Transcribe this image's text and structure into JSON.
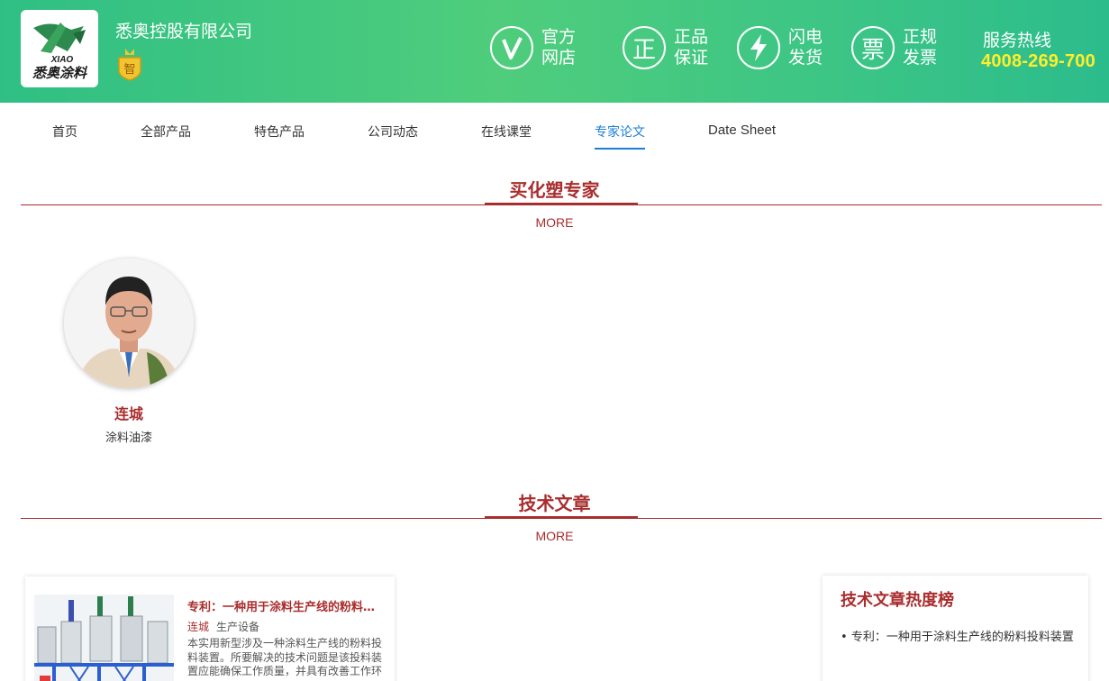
{
  "header": {
    "company_name": "悉奥控股有限公司",
    "logo_text": "悉奥涂料",
    "logo_sub": "XIAO",
    "badge_text": "智",
    "features": [
      {
        "icon": "v-check-icon",
        "glyph": "V",
        "line1": "官方",
        "line2": "网店"
      },
      {
        "icon": "zheng-icon",
        "glyph": "正",
        "line1": "正品",
        "line2": "保证"
      },
      {
        "icon": "lightning-icon",
        "glyph": "⚡",
        "line1": "闪电",
        "line2": "发货"
      },
      {
        "icon": "piao-icon",
        "glyph": "票",
        "line1": "正规",
        "line2": "发票"
      }
    ],
    "hotline_label": "服务热线",
    "hotline_number": "4008-269-700"
  },
  "nav": {
    "items": [
      "首页",
      "全部产品",
      "特色产品",
      "公司动态",
      "在线课堂",
      "专家论文",
      "Date Sheet"
    ],
    "active": "专家论文"
  },
  "experts_section": {
    "title": "买化塑专家",
    "more": "MORE",
    "experts": [
      {
        "name": "连城",
        "field": "涂料油漆"
      }
    ]
  },
  "articles_section": {
    "title": "技术文章",
    "more": "MORE",
    "articles": [
      {
        "title": "专利：一种用于涂料生产线的粉料投料装置",
        "author": "连城",
        "category": "生产设备",
        "description": "本实用新型涉及一种涂料生产线的粉料投料装置。所要解决的技术问题是该投料装置应能确保工作质量，并具有改善工作环"
      }
    ]
  },
  "hot_list": {
    "title": "技术文章热度榜",
    "items": [
      "专利：一种用于涂料生产线的粉料投料装置"
    ]
  },
  "colors": {
    "header_green": "#4fcd7c",
    "accent_red": "#a92d2d",
    "nav_active_blue": "#1a7fd6",
    "hotline_yellow": "#ffee2a"
  }
}
